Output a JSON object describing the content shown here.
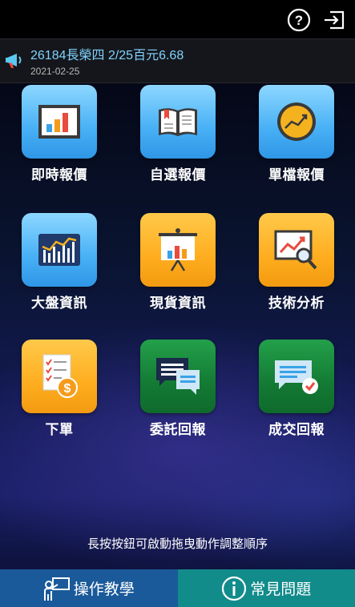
{
  "colors": {
    "accent_blue": "#47b0f5",
    "accent_orange": "#ffad1f",
    "accent_green": "#137a34",
    "news_text": "#7fd3ff"
  },
  "header": {
    "help_icon": "question-circle-icon",
    "logout_icon": "logout-icon"
  },
  "news": {
    "icon": "megaphone-icon",
    "title": "26184長榮四 2/25百元6.68",
    "date": "2021-02-25"
  },
  "menu": [
    {
      "label": "即時報價",
      "icon": "bar-chart-icon",
      "color": "blue"
    },
    {
      "label": "自選報價",
      "icon": "bookmark-book-icon",
      "color": "blue"
    },
    {
      "label": "單檔報價",
      "icon": "gauge-icon",
      "color": "blue"
    },
    {
      "label": "大盤資訊",
      "icon": "market-bars-icon",
      "color": "blue"
    },
    {
      "label": "現貨資訊",
      "icon": "presentation-board-icon",
      "color": "orange"
    },
    {
      "label": "技術分析",
      "icon": "magnifier-chart-icon",
      "color": "orange"
    },
    {
      "label": "下單",
      "icon": "order-form-icon",
      "color": "orange"
    },
    {
      "label": "委託回報",
      "icon": "chat-bubbles-icon",
      "color": "green"
    },
    {
      "label": "成交回報",
      "icon": "chat-check-icon",
      "color": "green"
    }
  ],
  "hint": "長按按鈕可啟動拖曳動作調整順序",
  "bottom": {
    "tutorial_label": "操作教學",
    "tutorial_icon": "teacher-icon",
    "faq_label": "常見問題",
    "faq_icon": "info-circle-icon"
  }
}
